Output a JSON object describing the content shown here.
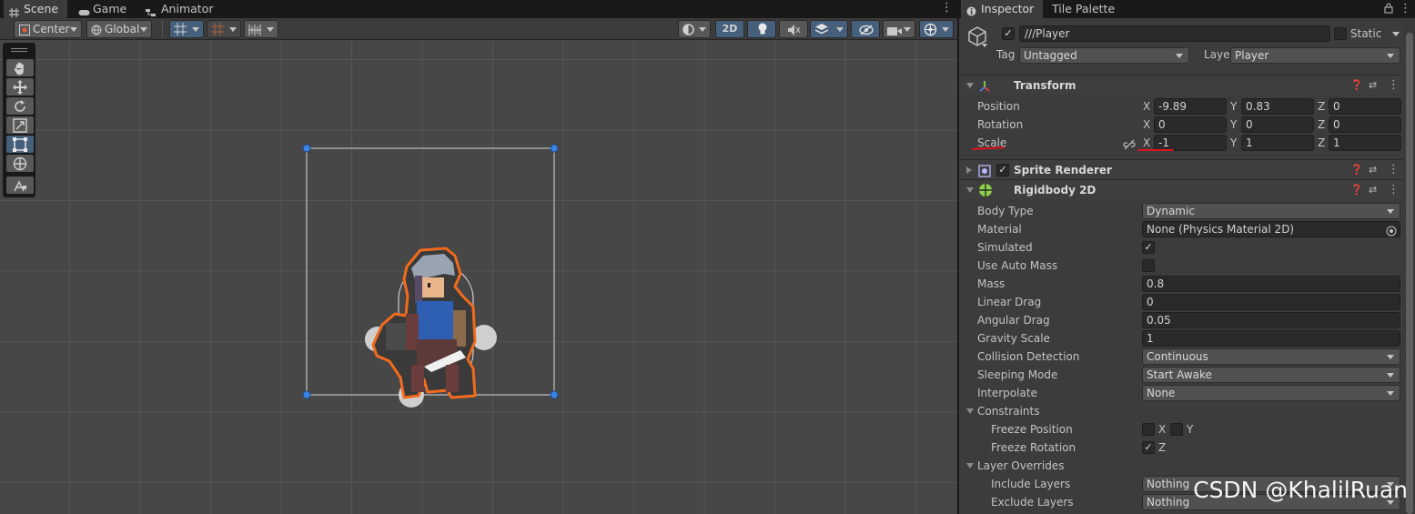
{
  "scene_tabs": [
    {
      "label": "Scene",
      "icon": "grid-icon"
    },
    {
      "label": "Game",
      "icon": "gamepad-icon"
    },
    {
      "label": "Animator",
      "icon": "animator-icon"
    }
  ],
  "scene_toolbar": {
    "pivot_mode": "Center",
    "pivot_rotation": "Global",
    "mode_2d": "2D"
  },
  "inspector_tabs": [
    {
      "label": "Inspector",
      "icon": "info-icon"
    },
    {
      "label": "Tile Palette"
    }
  ],
  "game_object": {
    "active": true,
    "name": "///Player",
    "static_label": "Static",
    "tag_label": "Tag",
    "tag_value": "Untagged",
    "layer_label": "Layer",
    "layer_value": "Player"
  },
  "transform": {
    "title": "Transform",
    "position": {
      "label": "Position",
      "x": "-9.89",
      "y": "0.83",
      "z": "0"
    },
    "rotation": {
      "label": "Rotation",
      "x": "0",
      "y": "0",
      "z": "0"
    },
    "scale": {
      "label": "Scale",
      "x": "-1",
      "y": "1",
      "z": "1"
    },
    "axis_x": "X",
    "axis_y": "Y",
    "axis_z": "Z"
  },
  "sprite_renderer": {
    "title": "Sprite Renderer",
    "enabled": true
  },
  "rigidbody2d": {
    "title": "Rigidbody 2D",
    "body_type": {
      "label": "Body Type",
      "value": "Dynamic"
    },
    "material": {
      "label": "Material",
      "value": "None (Physics Material 2D)"
    },
    "simulated": {
      "label": "Simulated",
      "checked": true
    },
    "use_auto_mass": {
      "label": "Use Auto Mass",
      "checked": false
    },
    "mass": {
      "label": "Mass",
      "value": "0.8"
    },
    "linear_drag": {
      "label": "Linear Drag",
      "value": "0"
    },
    "angular_drag": {
      "label": "Angular Drag",
      "value": "0.05"
    },
    "gravity_scale": {
      "label": "Gravity Scale",
      "value": "1"
    },
    "collision_detection": {
      "label": "Collision Detection",
      "value": "Continuous"
    },
    "sleeping_mode": {
      "label": "Sleeping Mode",
      "value": "Start Awake"
    },
    "interpolate": {
      "label": "Interpolate",
      "value": "None"
    },
    "constraints": {
      "label": "Constraints",
      "freeze_position": {
        "label": "Freeze Position",
        "x": false,
        "y": false
      },
      "freeze_rotation": {
        "label": "Freeze Rotation",
        "z": true
      }
    },
    "layer_overrides": {
      "label": "Layer Overrides",
      "include_layers": {
        "label": "Include Layers",
        "value": "Nothing"
      },
      "exclude_layers": {
        "label": "Exclude Layers",
        "value": "Nothing"
      }
    }
  },
  "watermark": "CSDN @KhalilRuan",
  "colors": {
    "selection_outline": "#f26b1d",
    "handle_blue": "#3b82e6",
    "annotation_red": "#e0131b"
  }
}
